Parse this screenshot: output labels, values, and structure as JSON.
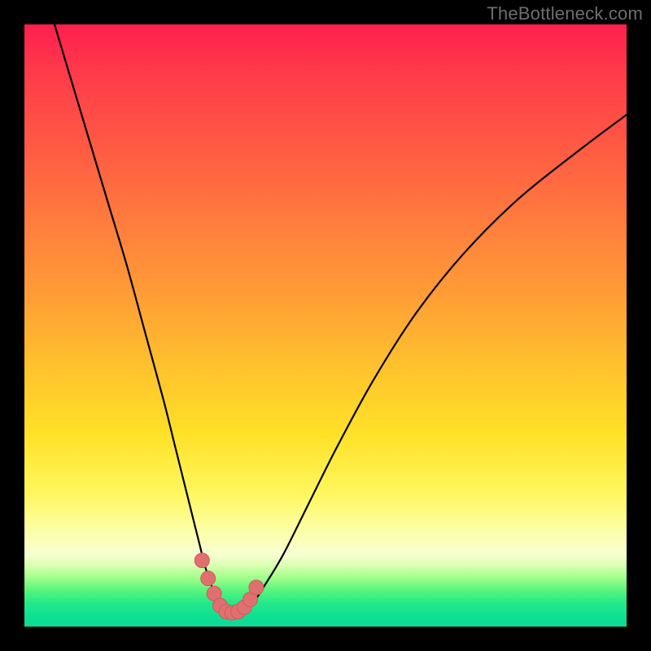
{
  "watermark": {
    "text": "TheBottleneck.com"
  },
  "colors": {
    "frame": "#000000",
    "curve": "#000000",
    "marker": "#e07070",
    "marker_stroke": "#cf5a5a"
  },
  "chart_data": {
    "type": "line",
    "title": "",
    "xlabel": "",
    "ylabel": "",
    "xlim": [
      0,
      100
    ],
    "ylim": [
      0,
      100
    ],
    "grid": false,
    "legend": false,
    "series": [
      {
        "name": "bottleneck-curve",
        "x": [
          5,
          8,
          11,
          14,
          17,
          20,
          23,
          25,
          27,
          29,
          30,
          31,
          32,
          33,
          34,
          35,
          36,
          38,
          40,
          43,
          47,
          52,
          58,
          65,
          73,
          82,
          92,
          100
        ],
        "values": [
          100,
          90,
          80,
          70,
          60,
          49,
          38,
          30,
          22,
          14,
          10,
          7,
          4,
          2.5,
          2,
          2,
          2.5,
          4,
          7,
          12,
          20,
          30,
          41,
          52,
          62,
          71,
          79,
          85
        ]
      }
    ],
    "markers": {
      "name": "highlight-dots",
      "x": [
        29.5,
        30.5,
        31.5,
        32.5,
        33.5,
        34.5,
        35.5,
        36.5,
        37.5,
        38.5
      ],
      "values": [
        11,
        8,
        5.5,
        3.5,
        2.5,
        2.3,
        2.5,
        3.2,
        4.5,
        6.5
      ]
    }
  }
}
